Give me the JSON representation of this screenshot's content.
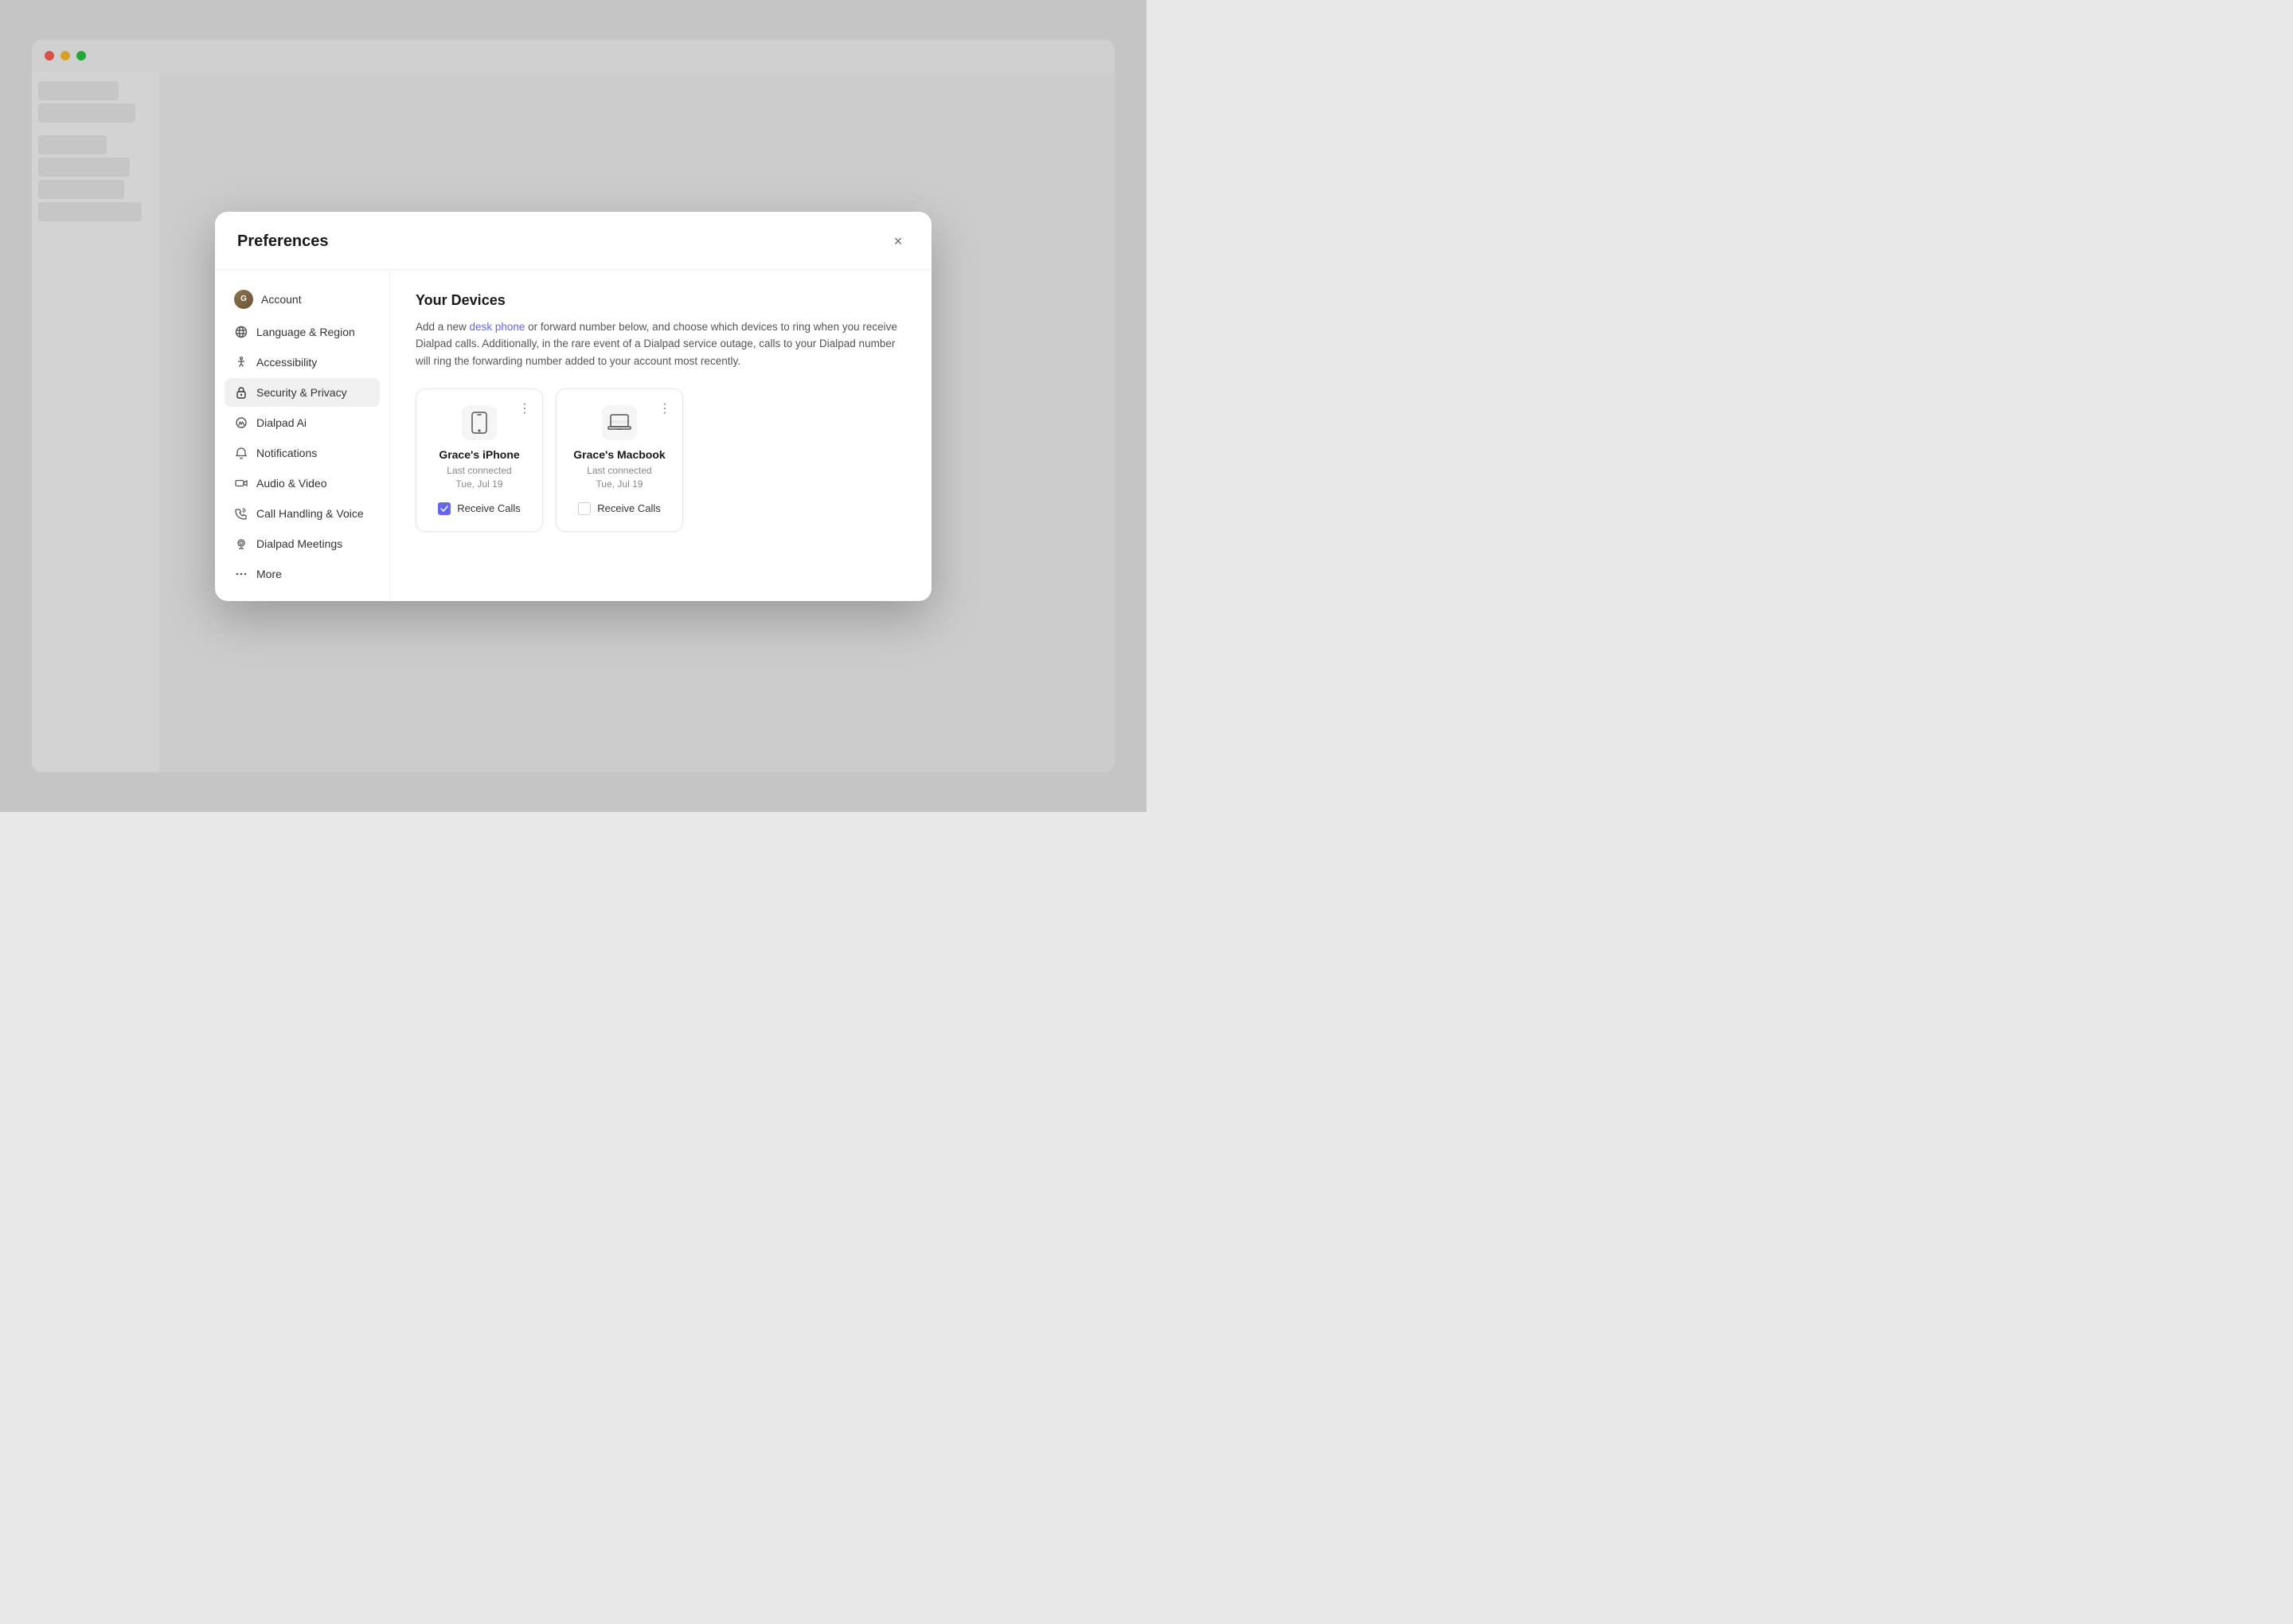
{
  "modal": {
    "title": "Preferences",
    "close_label": "×"
  },
  "nav": {
    "items": [
      {
        "id": "account",
        "label": "Account",
        "icon": "avatar",
        "active": false
      },
      {
        "id": "language",
        "label": "Language & Region",
        "icon": "language",
        "active": false
      },
      {
        "id": "accessibility",
        "label": "Accessibility",
        "icon": "accessibility",
        "active": false
      },
      {
        "id": "security",
        "label": "Security & Privacy",
        "icon": "lock",
        "active": true
      },
      {
        "id": "dialpad-ai",
        "label": "Dialpad Ai",
        "icon": "ai",
        "active": false
      },
      {
        "id": "notifications",
        "label": "Notifications",
        "icon": "bell",
        "active": false
      },
      {
        "id": "audio-video",
        "label": "Audio & Video",
        "icon": "camera",
        "active": false
      },
      {
        "id": "call-handling",
        "label": "Call Handling & Voice",
        "icon": "phone",
        "active": false
      },
      {
        "id": "meetings",
        "label": "Dialpad Meetings",
        "icon": "webcam",
        "active": false
      },
      {
        "id": "more",
        "label": "More",
        "icon": "more",
        "active": false
      }
    ]
  },
  "content": {
    "title": "Your Devices",
    "description_part1": "Add a new ",
    "desk_phone_link": "desk phone",
    "description_part2": " or forward number below, and choose which devices to ring when you receive Dialpad calls. Additionally, in the rare event of a Dialpad service outage, calls to your Dialpad number will ring the forwarding number added to your account most recently."
  },
  "devices": [
    {
      "id": "iphone",
      "name": "Grace's iPhone",
      "icon": "mobile",
      "last_connected_label": "Last connected",
      "last_connected_date": "Tue, Jul 19",
      "receive_calls": true,
      "receive_calls_label": "Receive Calls"
    },
    {
      "id": "macbook",
      "name": "Grace's Macbook",
      "icon": "laptop",
      "last_connected_label": "Last connected",
      "last_connected_date": "Tue, Jul 19",
      "receive_calls": false,
      "receive_calls_label": "Receive Calls"
    }
  ],
  "colors": {
    "accent": "#6366f1",
    "active_nav_bg": "#f0f0f0",
    "card_border": "#e8e8e8"
  }
}
